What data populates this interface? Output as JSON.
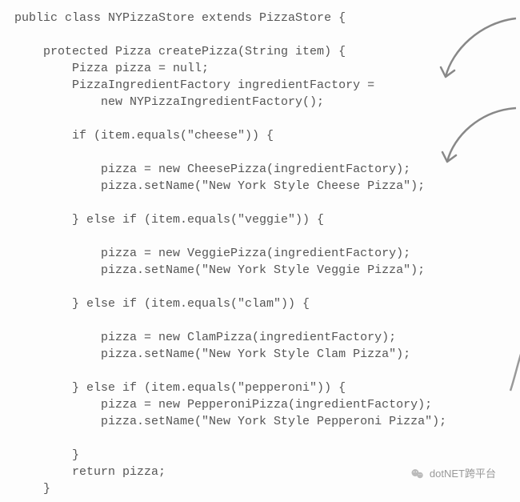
{
  "code": {
    "l01": "public class NYPizzaStore extends PizzaStore {",
    "l02": "",
    "l03": "    protected Pizza createPizza(String item) {",
    "l04": "        Pizza pizza = null;",
    "l05": "        PizzaIngredientFactory ingredientFactory =",
    "l06": "            new NYPizzaIngredientFactory();",
    "l07": "",
    "l08": "        if (item.equals(\"cheese\")) {",
    "l09": "",
    "l10": "            pizza = new CheesePizza(ingredientFactory);",
    "l11": "            pizza.setName(\"New York Style Cheese Pizza\");",
    "l12": "",
    "l13": "        } else if (item.equals(\"veggie\")) {",
    "l14": "",
    "l15": "            pizza = new VeggiePizza(ingredientFactory);",
    "l16": "            pizza.setName(\"New York Style Veggie Pizza\");",
    "l17": "",
    "l18": "        } else if (item.equals(\"clam\")) {",
    "l19": "",
    "l20": "            pizza = new ClamPizza(ingredientFactory);",
    "l21": "            pizza.setName(\"New York Style Clam Pizza\");",
    "l22": "",
    "l23": "        } else if (item.equals(\"pepperoni\")) {",
    "l24": "            pizza = new PepperoniPizza(ingredientFactory);",
    "l25": "            pizza.setName(\"New York Style Pepperoni Pizza\");",
    "l26": "",
    "l27": "        }",
    "l28": "        return pizza;",
    "l29": "    }"
  },
  "watermark": {
    "text": "dotNET跨平台"
  }
}
